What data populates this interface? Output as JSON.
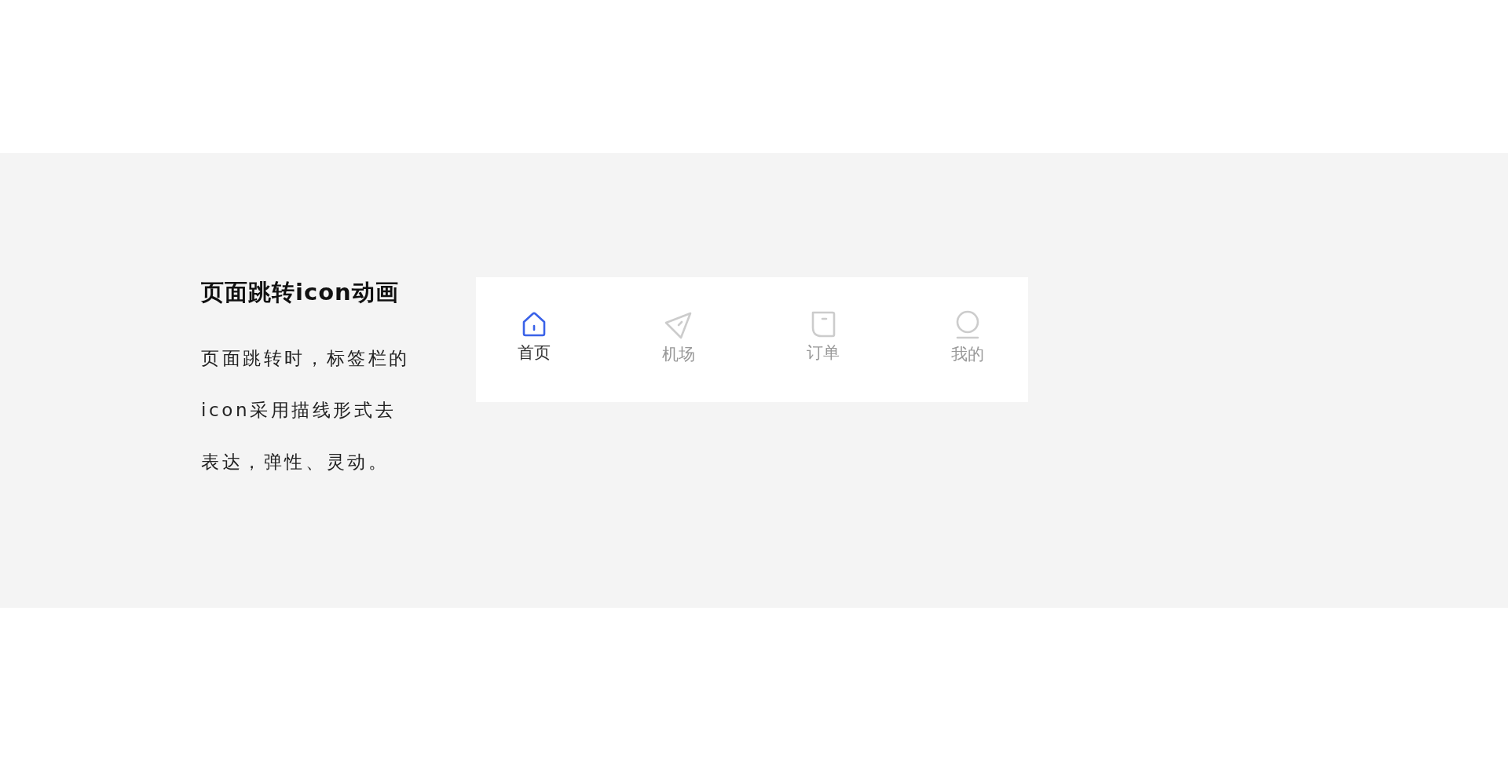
{
  "section": {
    "title": "页面跳转icon动画",
    "description": "页面跳转时，标签栏的icon采用描线形式去表达，弹性、灵动。"
  },
  "tab_bar": {
    "tabs": [
      {
        "label": "首页",
        "kind": "home",
        "selected": true
      },
      {
        "label": "机场",
        "kind": "send",
        "selected": false
      },
      {
        "label": "订单",
        "kind": "order",
        "selected": false
      },
      {
        "label": "我的",
        "kind": "profile",
        "selected": false
      }
    ]
  }
}
